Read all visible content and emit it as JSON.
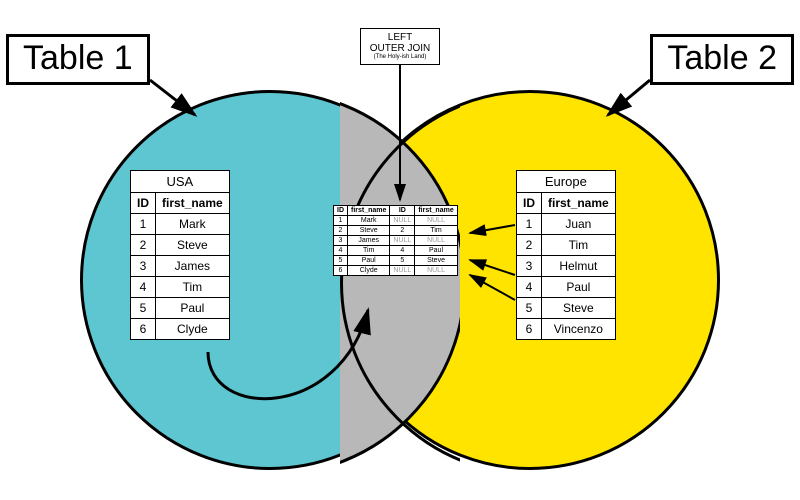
{
  "labels": {
    "table1": "Table 1",
    "table2": "Table 2",
    "center_line1": "LEFT",
    "center_line2": "OUTER JOIN",
    "center_sub": "(The Holy-ish Land)"
  },
  "left_table": {
    "title": "USA",
    "cols": [
      "ID",
      "first_name"
    ],
    "rows": [
      [
        "1",
        "Mark"
      ],
      [
        "2",
        "Steve"
      ],
      [
        "3",
        "James"
      ],
      [
        "4",
        "Tim"
      ],
      [
        "5",
        "Paul"
      ],
      [
        "6",
        "Clyde"
      ]
    ]
  },
  "right_table": {
    "title": "Europe",
    "cols": [
      "ID",
      "first_name"
    ],
    "rows": [
      [
        "1",
        "Juan"
      ],
      [
        "2",
        "Tim"
      ],
      [
        "3",
        "Helmut"
      ],
      [
        "4",
        "Paul"
      ],
      [
        "5",
        "Steve"
      ],
      [
        "6",
        "Vincenzo"
      ]
    ]
  },
  "center_table": {
    "cols": [
      "ID",
      "first_name",
      "ID",
      "first_name"
    ],
    "rows": [
      [
        "1",
        "Mark",
        "NULL",
        "NULL"
      ],
      [
        "2",
        "Steve",
        "2",
        "Tim"
      ],
      [
        "3",
        "James",
        "NULL",
        "NULL"
      ],
      [
        "4",
        "Tim",
        "4",
        "Paul"
      ],
      [
        "5",
        "Paul",
        "5",
        "Steve"
      ],
      [
        "6",
        "Clyde",
        "NULL",
        "NULL"
      ]
    ]
  },
  "chart_data": {
    "type": "table",
    "description": "Venn diagram illustrating SQL LEFT OUTER JOIN between Table 1 (USA) and Table 2 (Europe)",
    "left_set": {
      "label": "Table 1 / USA",
      "rows": [
        {
          "ID": 1,
          "first_name": "Mark"
        },
        {
          "ID": 2,
          "first_name": "Steve"
        },
        {
          "ID": 3,
          "first_name": "James"
        },
        {
          "ID": 4,
          "first_name": "Tim"
        },
        {
          "ID": 5,
          "first_name": "Paul"
        },
        {
          "ID": 6,
          "first_name": "Clyde"
        }
      ]
    },
    "right_set": {
      "label": "Table 2 / Europe",
      "rows": [
        {
          "ID": 1,
          "first_name": "Juan"
        },
        {
          "ID": 2,
          "first_name": "Tim"
        },
        {
          "ID": 3,
          "first_name": "Helmut"
        },
        {
          "ID": 4,
          "first_name": "Paul"
        },
        {
          "ID": 5,
          "first_name": "Steve"
        },
        {
          "ID": 6,
          "first_name": "Vincenzo"
        }
      ]
    },
    "join_result": {
      "label": "LEFT OUTER JOIN",
      "rows": [
        {
          "l_ID": 1,
          "l_first_name": "Mark",
          "r_ID": null,
          "r_first_name": null
        },
        {
          "l_ID": 2,
          "l_first_name": "Steve",
          "r_ID": 2,
          "r_first_name": "Tim"
        },
        {
          "l_ID": 3,
          "l_first_name": "James",
          "r_ID": null,
          "r_first_name": null
        },
        {
          "l_ID": 4,
          "l_first_name": "Tim",
          "r_ID": 4,
          "r_first_name": "Paul"
        },
        {
          "l_ID": 5,
          "l_first_name": "Paul",
          "r_ID": 5,
          "r_first_name": "Steve"
        },
        {
          "l_ID": 6,
          "l_first_name": "Clyde",
          "r_ID": null,
          "r_first_name": null
        }
      ]
    }
  }
}
